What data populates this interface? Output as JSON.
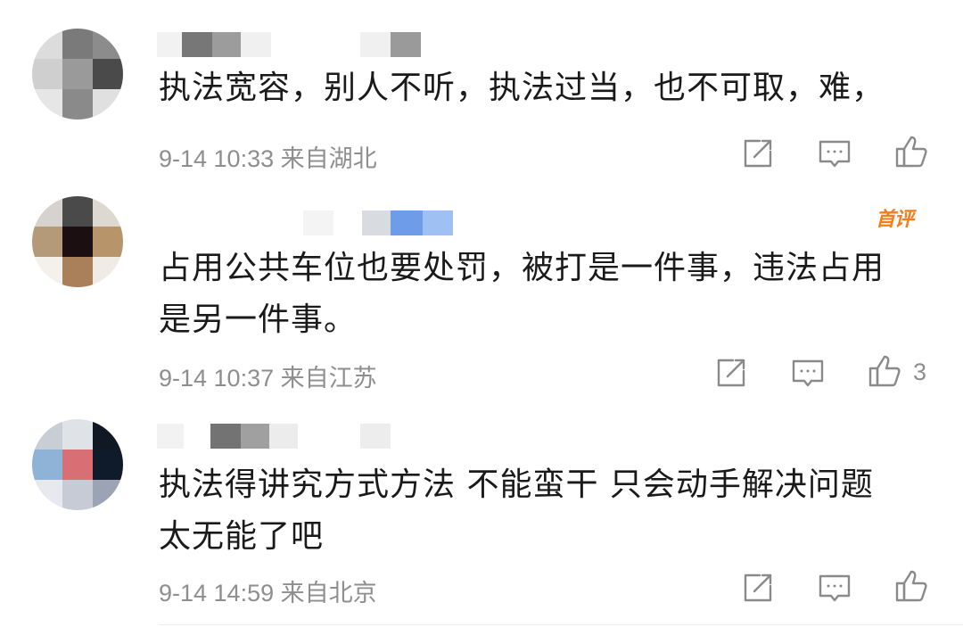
{
  "comments": [
    {
      "text_lines": [
        "执法宽容，别人不听，执法过当，也不可取，难，"
      ],
      "timestamp": "9-14 10:33",
      "location": "来自湖北",
      "like_count": ""
    },
    {
      "badge": "首评",
      "text_lines": [
        "占用公共车位也要处罚，被打是一件事，违法占用",
        "是另一件事。"
      ],
      "timestamp": "9-14 10:37",
      "location": "来自江苏",
      "like_count": "3"
    },
    {
      "text_lines": [
        "执法得讲究方式方法 不能蛮干 只会动手解决问题",
        "太无能了吧"
      ],
      "timestamp": "9-14 14:59",
      "location": "来自北京",
      "like_count": ""
    }
  ],
  "icons": {
    "share": "share-icon",
    "comment": "comment-icon",
    "like": "thumbs-up-icon"
  },
  "colors": {
    "text": "#1a1a1a",
    "meta": "#8e8e8e",
    "badge": "#f07f1e",
    "icon": "#8a8a8a"
  }
}
